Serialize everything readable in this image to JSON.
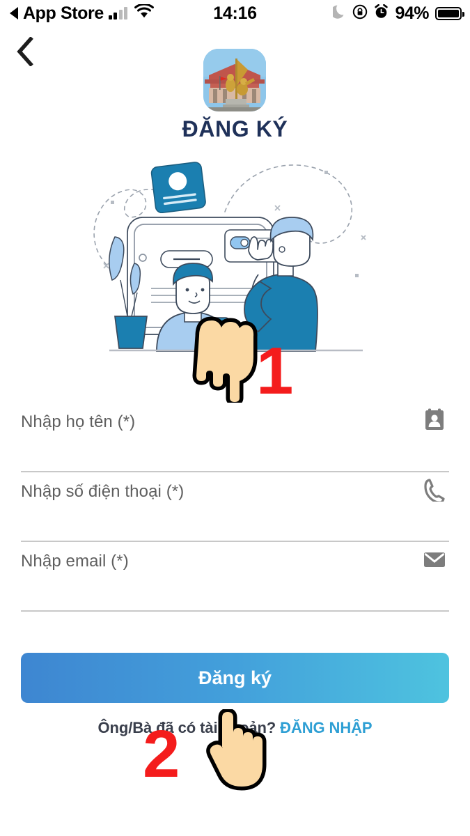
{
  "statusbar": {
    "back_affordance_icon": "back-triangle-icon",
    "carrier_label": "App Store",
    "signal_icon": "cellular-signal-icon",
    "wifi_icon": "wifi-icon",
    "time": "14:16",
    "dnd_icon": "moon-do-not-disturb-icon",
    "rotation_lock_icon": "rotation-lock-icon",
    "alarm_icon": "alarm-clock-icon",
    "battery_percent": "94%",
    "battery_icon": "battery-full-icon"
  },
  "nav": {
    "back_icon": "chevron-left-icon"
  },
  "header": {
    "app_icon": "monument-statue-app-icon",
    "title": "ĐĂNG KÝ"
  },
  "illustration": {
    "name": "registration-illustration",
    "colors": {
      "dark_blue": "#1b7fb0",
      "mid_blue": "#2a8fc0",
      "light_blue": "#a8cdf0",
      "pale_blue": "#cfe3f8",
      "line": "#3d4a5c",
      "ground": "#b8bcc4"
    }
  },
  "form": {
    "fields": [
      {
        "label": "Nhập họ tên (*)",
        "value": "",
        "icon": "contact-card-icon",
        "name": "fullname-input"
      },
      {
        "label": "Nhập số điện thoại (*)",
        "value": "",
        "icon": "phone-icon",
        "name": "phone-input"
      },
      {
        "label": "Nhập email (*)",
        "value": "",
        "icon": "envelope-icon",
        "name": "email-input"
      }
    ]
  },
  "submit": {
    "label": "Đăng ký",
    "gradient_start": "#3e86d1",
    "gradient_end": "#4ec3df"
  },
  "footer": {
    "prompt": "Ông/Bà đã có tài khoản?",
    "link": "ĐĂNG NHẬP",
    "link_color": "#2e9fd4"
  },
  "annotations": {
    "marker_one": "1",
    "marker_two": "2",
    "marker_color": "#f41c1c",
    "cursor_one": "hand-pointing-down-cursor",
    "cursor_two": "hand-pointing-up-cursor"
  }
}
